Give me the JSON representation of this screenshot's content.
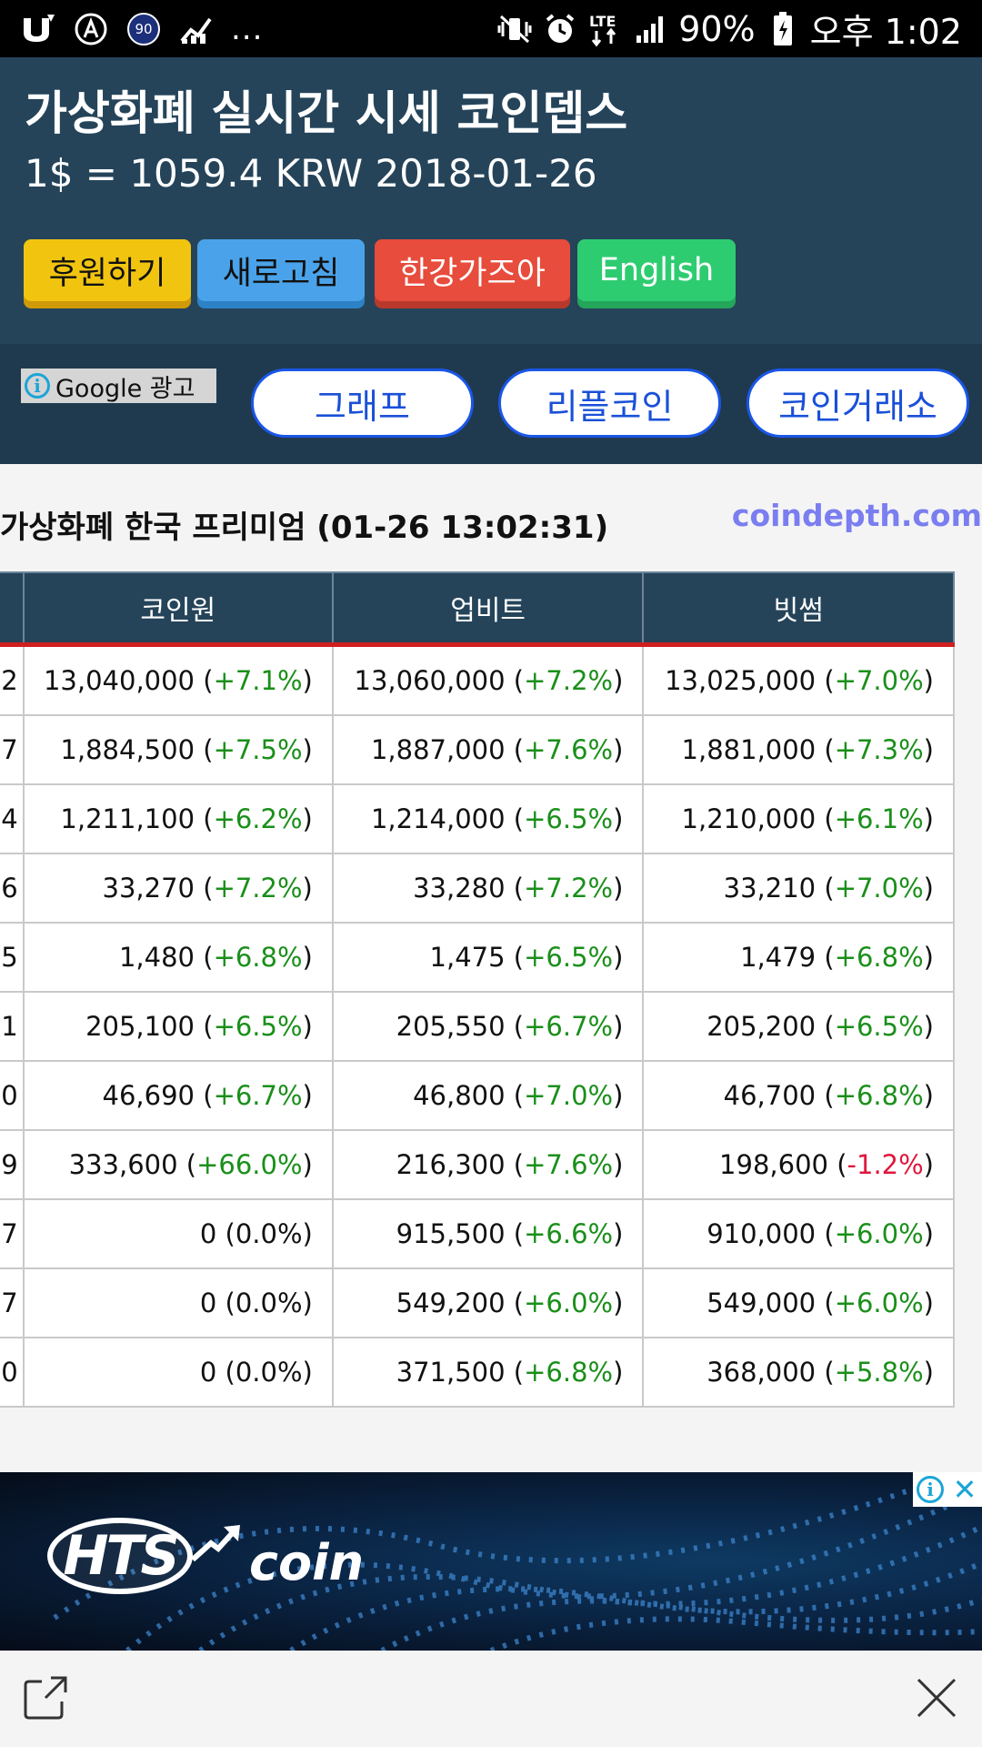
{
  "status_bar": {
    "left_icons": [
      "app-u-icon",
      "app-a-icon",
      "badge-90-icon",
      "stock-chart-icon"
    ],
    "badge_text": "90",
    "overflow": "...",
    "battery_text": "90%",
    "time": "오후 1:02",
    "right_icons": [
      "vibrate-mute-icon",
      "alarm-icon",
      "lte-icon",
      "signal-icon",
      "battery-icon"
    ]
  },
  "header": {
    "title": "가상화폐 실시간 시세 코인뎁스",
    "rate": "1$ = 1059.4 KRW 2018-01-26",
    "buttons": {
      "support": "후원하기",
      "refresh": "새로고침",
      "hangang": "한강가즈아",
      "english": "English"
    },
    "colors": {
      "header_bg": "#25445a",
      "support": "#f1c40f",
      "refresh": "#4aa3ea",
      "hangang": "#e74c3c",
      "english": "#2ecc71"
    }
  },
  "nav": {
    "ad_label": "Google 광고",
    "graph": "그래프",
    "ripple": "리플코인",
    "exchange": "코인거래소"
  },
  "premium": {
    "title": "가상화폐 한국 프리미엄 (01-26 13:02:31)",
    "site": "coindepth.com",
    "columns": [
      "코인원",
      "업비트",
      "빗썸"
    ],
    "rows": [
      {
        "edge": "2",
        "cells": [
          {
            "price": "13,040,000",
            "pct": "+7.1%",
            "dir": "pos"
          },
          {
            "price": "13,060,000",
            "pct": "+7.2%",
            "dir": "pos"
          },
          {
            "price": "13,025,000",
            "pct": "+7.0%",
            "dir": "pos"
          }
        ]
      },
      {
        "edge": "7",
        "cells": [
          {
            "price": "1,884,500",
            "pct": "+7.5%",
            "dir": "pos"
          },
          {
            "price": "1,887,000",
            "pct": "+7.6%",
            "dir": "pos"
          },
          {
            "price": "1,881,000",
            "pct": "+7.3%",
            "dir": "pos"
          }
        ]
      },
      {
        "edge": "4",
        "cells": [
          {
            "price": "1,211,100",
            "pct": "+6.2%",
            "dir": "pos"
          },
          {
            "price": "1,214,000",
            "pct": "+6.5%",
            "dir": "pos"
          },
          {
            "price": "1,210,000",
            "pct": "+6.1%",
            "dir": "pos"
          }
        ]
      },
      {
        "edge": "6",
        "cells": [
          {
            "price": "33,270",
            "pct": "+7.2%",
            "dir": "pos"
          },
          {
            "price": "33,280",
            "pct": "+7.2%",
            "dir": "pos"
          },
          {
            "price": "33,210",
            "pct": "+7.0%",
            "dir": "pos"
          }
        ]
      },
      {
        "edge": "5",
        "cells": [
          {
            "price": "1,480",
            "pct": "+6.8%",
            "dir": "pos"
          },
          {
            "price": "1,475",
            "pct": "+6.5%",
            "dir": "pos"
          },
          {
            "price": "1,479",
            "pct": "+6.8%",
            "dir": "pos"
          }
        ]
      },
      {
        "edge": "1",
        "cells": [
          {
            "price": "205,100",
            "pct": "+6.5%",
            "dir": "pos"
          },
          {
            "price": "205,550",
            "pct": "+6.7%",
            "dir": "pos"
          },
          {
            "price": "205,200",
            "pct": "+6.5%",
            "dir": "pos"
          }
        ]
      },
      {
        "edge": "0",
        "cells": [
          {
            "price": "46,690",
            "pct": "+6.7%",
            "dir": "pos"
          },
          {
            "price": "46,800",
            "pct": "+7.0%",
            "dir": "pos"
          },
          {
            "price": "46,700",
            "pct": "+6.8%",
            "dir": "pos"
          }
        ]
      },
      {
        "edge": "9",
        "cells": [
          {
            "price": "333,600",
            "pct": "+66.0%",
            "dir": "pos"
          },
          {
            "price": "216,300",
            "pct": "+7.6%",
            "dir": "pos"
          },
          {
            "price": "198,600",
            "pct": "-1.2%",
            "dir": "neg"
          }
        ]
      },
      {
        "edge": "7",
        "cells": [
          {
            "price": "0",
            "pct": "0.0%",
            "dir": "flat"
          },
          {
            "price": "915,500",
            "pct": "+6.6%",
            "dir": "pos"
          },
          {
            "price": "910,000",
            "pct": "+6.0%",
            "dir": "pos"
          }
        ]
      },
      {
        "edge": "7",
        "cells": [
          {
            "price": "0",
            "pct": "0.0%",
            "dir": "flat"
          },
          {
            "price": "549,200",
            "pct": "+6.0%",
            "dir": "pos"
          },
          {
            "price": "549,000",
            "pct": "+6.0%",
            "dir": "pos"
          }
        ]
      },
      {
        "edge": "0",
        "cells": [
          {
            "price": "0",
            "pct": "0.0%",
            "dir": "flat"
          },
          {
            "price": "371,500",
            "pct": "+6.8%",
            "dir": "pos"
          },
          {
            "price": "368,000",
            "pct": "+5.8%",
            "dir": "pos"
          }
        ]
      }
    ],
    "colors": {
      "positive": "#1a8f1a",
      "negative": "#e0173d",
      "header_row_border": "#d01f1f"
    }
  },
  "ad_banner": {
    "logo_hts": "HTS",
    "logo_coin": "coin"
  },
  "bottom_bar": {
    "icons": [
      "external-link-icon",
      "close-icon"
    ]
  }
}
